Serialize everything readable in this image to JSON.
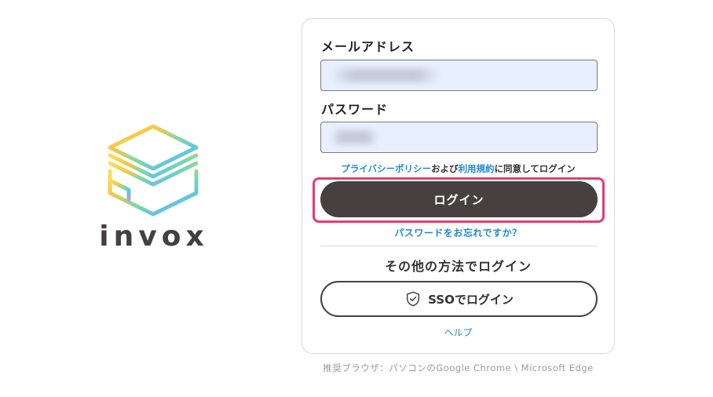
{
  "brand": {
    "name": "invox"
  },
  "login": {
    "email_label": "メールアドレス",
    "email_value": "",
    "password_label": "パスワード",
    "password_value": "",
    "consent_privacy_link": "プライバシーポリシー",
    "consent_and": "および",
    "consent_terms_link": "利用規約",
    "consent_suffix": "に同意してログイン",
    "login_button": "ログイン",
    "forgot_password_link": "パスワードをお忘れですか？",
    "other_methods_title": "その他の方法でログイン",
    "sso_button": "SSOでログイン",
    "sso_icon": "shield-check-icon",
    "help_link": "ヘルプ"
  },
  "footer": {
    "browser_note": "推奨ブラウザ：パソコンのGoogle Chrome \\ Microsoft Edge"
  },
  "colors": {
    "button_dark": "#464140",
    "link_blue": "#1f8ad6",
    "input_bg": "#e8f0fe",
    "highlight_pink": "#e83a74"
  }
}
